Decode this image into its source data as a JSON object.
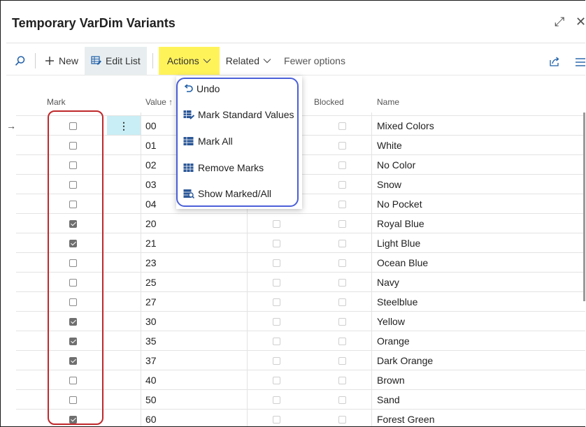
{
  "window": {
    "title": "Temporary VarDim Variants",
    "expand_glyph": "⤢",
    "close_glyph": "✕"
  },
  "toolbar": {
    "new_label": "New",
    "edit_list_label": "Edit List",
    "actions_label": "Actions",
    "related_label": "Related",
    "fewer_options_label": "Fewer options"
  },
  "columns": {
    "mark": "Mark",
    "value": "Value ↑",
    "blocked": "Blocked",
    "name": "Name"
  },
  "rows": [
    {
      "value": "00",
      "name": "Mixed Colors",
      "marked": false,
      "current": true
    },
    {
      "value": "01",
      "name": "White",
      "marked": false
    },
    {
      "value": "02",
      "name": "No Color",
      "marked": false
    },
    {
      "value": "03",
      "name": "Snow",
      "marked": false
    },
    {
      "value": "04",
      "name": "No Pocket",
      "marked": false
    },
    {
      "value": "20",
      "name": "Royal Blue",
      "marked": true
    },
    {
      "value": "21",
      "name": "Light Blue",
      "marked": true
    },
    {
      "value": "23",
      "name": "Ocean Blue",
      "marked": false
    },
    {
      "value": "25",
      "name": "Navy",
      "marked": false
    },
    {
      "value": "27",
      "name": "Steelblue",
      "marked": false
    },
    {
      "value": "30",
      "name": "Yellow",
      "marked": true
    },
    {
      "value": "35",
      "name": "Orange",
      "marked": true
    },
    {
      "value": "37",
      "name": "Dark Orange",
      "marked": true
    },
    {
      "value": "40",
      "name": "Brown",
      "marked": false
    },
    {
      "value": "50",
      "name": "Sand",
      "marked": false
    },
    {
      "value": "60",
      "name": "Forest Green",
      "marked": true
    }
  ],
  "row_markers": {
    "current_row_arrow": "→",
    "row_menu_glyph": "⋮"
  },
  "actions_menu": {
    "items": [
      {
        "label": "Undo",
        "icon": "undo-icon"
      },
      {
        "label": "Mark Standard Values",
        "icon": "mark-standard-icon"
      },
      {
        "label": "Mark All",
        "icon": "mark-all-icon"
      },
      {
        "label": "Remove Marks",
        "icon": "remove-marks-icon"
      },
      {
        "label": "Show Marked/All",
        "icon": "show-marked-icon"
      }
    ]
  },
  "colors": {
    "actions_highlight": "#fff35a",
    "annotation_red": "#c0282b",
    "annotation_blue": "#4a5fd8",
    "selected_cell": "#c9eef5"
  }
}
